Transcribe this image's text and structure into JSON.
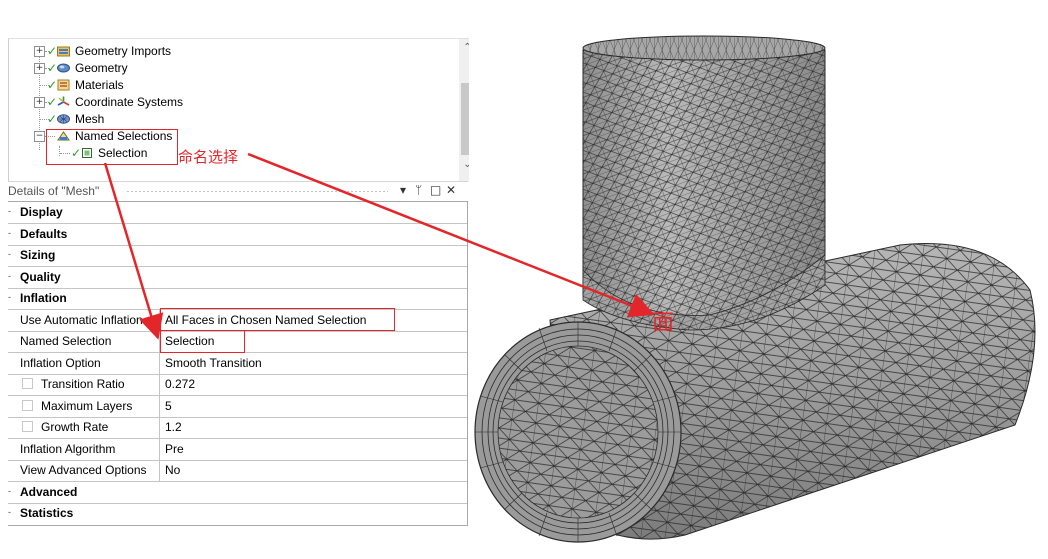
{
  "tree": {
    "items": [
      {
        "label": "Geometry Imports",
        "icon": "geometry-imports-icon",
        "status": "check"
      },
      {
        "label": "Geometry",
        "icon": "geometry-icon",
        "status": "check"
      },
      {
        "label": "Materials",
        "icon": "materials-icon",
        "status": "check"
      },
      {
        "label": "Coordinate Systems",
        "icon": "coordinate-systems-icon",
        "status": "check"
      },
      {
        "label": "Mesh",
        "icon": "mesh-icon",
        "status": "check"
      },
      {
        "label": "Named Selections",
        "icon": "named-selections-icon",
        "status": "none"
      },
      {
        "label": "Selection",
        "icon": "selection-icon",
        "status": "check"
      }
    ]
  },
  "details": {
    "title": "Details of \"Mesh\"",
    "buttons": {
      "dropdown": "▾",
      "pin": "ᛘ",
      "restore": "□",
      "close": "✕"
    },
    "rows": [
      {
        "type": "category",
        "label": "Display"
      },
      {
        "type": "category",
        "label": "Defaults"
      },
      {
        "type": "category",
        "label": "Sizing"
      },
      {
        "type": "category",
        "label": "Quality"
      },
      {
        "type": "category",
        "label": "Inflation"
      },
      {
        "type": "property",
        "name": "Use Automatic Inflation",
        "value": "All Faces in Chosen Named Selection"
      },
      {
        "type": "property",
        "name": "Named Selection",
        "value": "Selection"
      },
      {
        "type": "property",
        "name": "Inflation Option",
        "value": "Smooth Transition"
      },
      {
        "type": "property",
        "name": "Transition Ratio",
        "value": "0.272",
        "checkbox": true
      },
      {
        "type": "property",
        "name": "Maximum Layers",
        "value": "5",
        "checkbox": true
      },
      {
        "type": "property",
        "name": "Growth Rate",
        "value": "1.2",
        "checkbox": true
      },
      {
        "type": "property",
        "name": "Inflation Algorithm",
        "value": "Pre"
      },
      {
        "type": "property",
        "name": "View Advanced Options",
        "value": "No"
      },
      {
        "type": "category",
        "label": "Advanced"
      },
      {
        "type": "category",
        "label": "Statistics"
      }
    ]
  },
  "annotations": {
    "named_selection_label": "命名选择",
    "face_label": "面",
    "color": "#e3262a"
  },
  "mesh_view": {
    "fill": "#9a9a9a",
    "edge": "#2b2b2b"
  }
}
